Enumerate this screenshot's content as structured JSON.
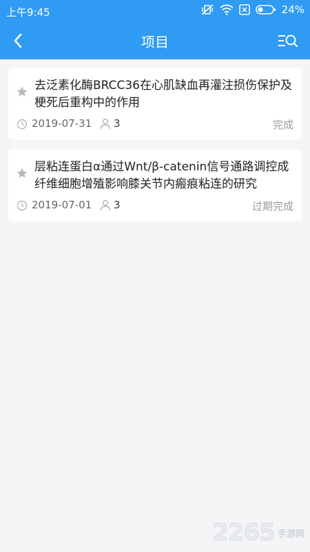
{
  "status_bar": {
    "time": "上午9:45",
    "battery": "24%",
    "icons": [
      "vibrate-icon",
      "wifi-icon",
      "sim-icon",
      "battery-icon"
    ]
  },
  "navbar": {
    "title": "项目",
    "back_icon": "back-arrow-icon",
    "search_icon": "list-search-icon"
  },
  "projects": [
    {
      "title": "去泛素化酶BRCC36在心肌缺血再灌注损伤保护及梗死后重构中的作用",
      "date": "2019-07-31",
      "members": "3",
      "status": "完成"
    },
    {
      "title": "层粘连蛋白α通过Wnt/β-catenin信号通路调控成纤维细胞增殖影响膝关节内瘢痕粘连的研究",
      "date": "2019-07-01",
      "members": "3",
      "status": "过期完成"
    }
  ],
  "watermark": {
    "number": "2265",
    "text": "手游网"
  },
  "colors": {
    "header": "#2f9bf3",
    "background": "#f4f5f7",
    "card": "#ffffff"
  }
}
